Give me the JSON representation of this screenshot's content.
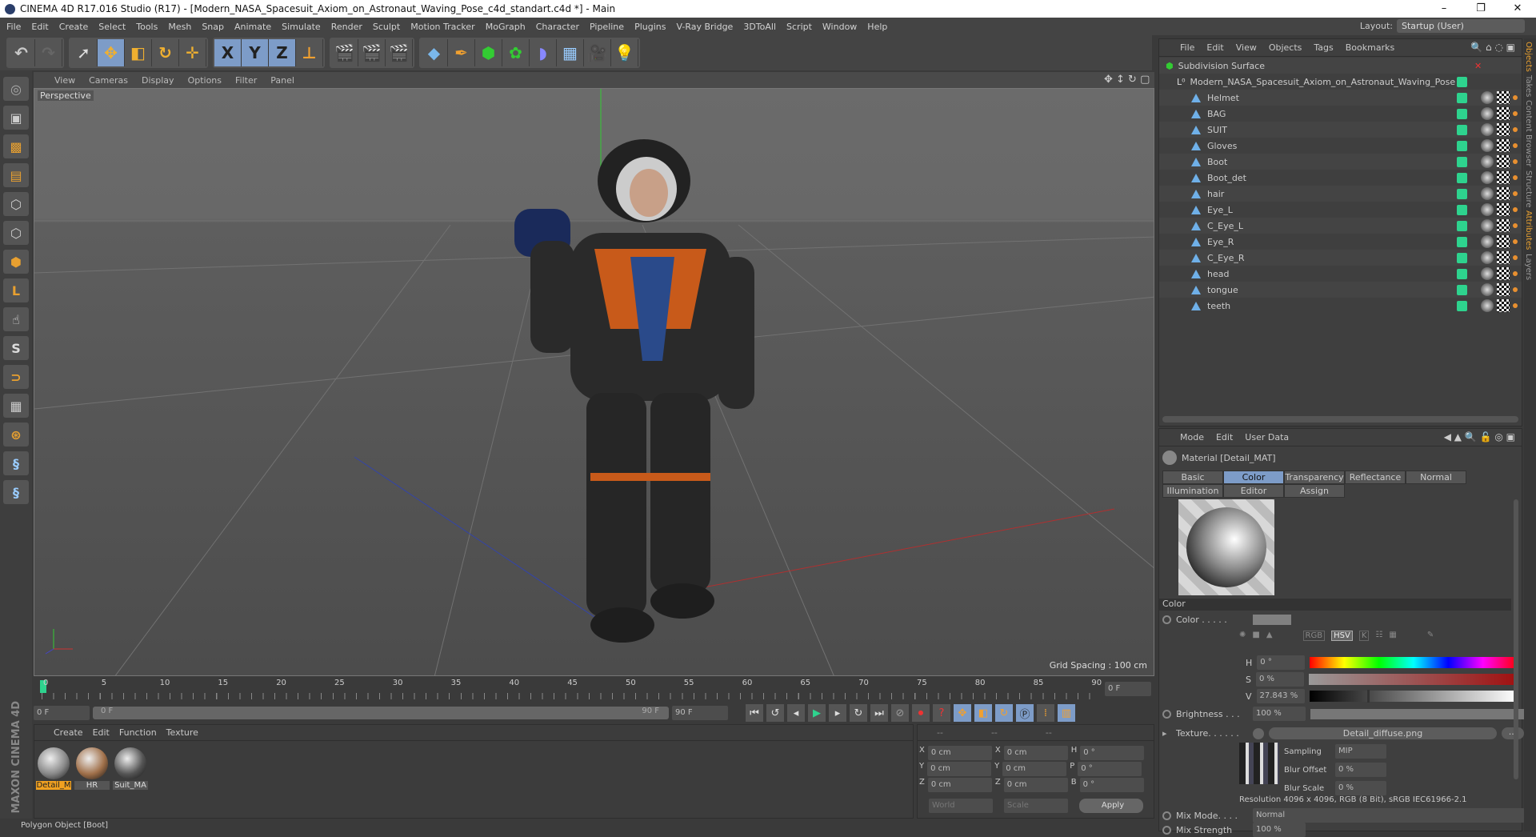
{
  "window": {
    "title": "CINEMA 4D R17.016 Studio (R17) - [Modern_NASA_Spacesuit_Axiom_on_Astronaut_Waving_Pose_c4d_standart.c4d *] - Main",
    "minimize": "–",
    "maximize": "❐",
    "close": "✕"
  },
  "menu": [
    "File",
    "Edit",
    "Create",
    "Select",
    "Tools",
    "Mesh",
    "Snap",
    "Animate",
    "Simulate",
    "Render",
    "Sculpt",
    "Motion Tracker",
    "MoGraph",
    "Character",
    "Pipeline",
    "Plugins",
    "V-Ray Bridge",
    "3DToAll",
    "Script",
    "Window",
    "Help"
  ],
  "layout": {
    "label": "Layout:",
    "value": "Startup (User)"
  },
  "toolbar": {
    "x": "X",
    "y": "Y",
    "z": "Z"
  },
  "viewport": {
    "menu": [
      "View",
      "Cameras",
      "Display",
      "Options",
      "Filter",
      "Panel"
    ],
    "camera": "Perspective",
    "grid_spacing": "Grid Spacing : 100 cm"
  },
  "timeline": {
    "ticks": [
      "0",
      "5",
      "10",
      "15",
      "20",
      "25",
      "30",
      "35",
      "40",
      "45",
      "50",
      "55",
      "60",
      "65",
      "70",
      "75",
      "80",
      "85",
      "90"
    ],
    "current": "0 F",
    "start": "0 F",
    "range_start": "0 F",
    "range_end": "90 F",
    "end": "90 F"
  },
  "material_manager": {
    "menu": [
      "Create",
      "Edit",
      "Function",
      "Texture"
    ],
    "materials": [
      {
        "name": "Detail_MAT",
        "label": "Detail_M",
        "color": "#888"
      },
      {
        "name": "HR",
        "label": "HR",
        "color": "#a0704a"
      },
      {
        "name": "Suit_MAT",
        "label": "Suit_MA",
        "color": "#555"
      }
    ]
  },
  "coordinates": {
    "headers": [
      "--",
      "--",
      "--"
    ],
    "rows": [
      {
        "a": "X",
        "av": "0 cm",
        "b": "X",
        "bv": "0 cm",
        "c": "H",
        "cv": "0 °"
      },
      {
        "a": "Y",
        "av": "0 cm",
        "b": "Y",
        "bv": "0 cm",
        "c": "P",
        "cv": "0 °"
      },
      {
        "a": "Z",
        "av": "0 cm",
        "b": "Z",
        "bv": "0 cm",
        "c": "B",
        "cv": "0 °"
      }
    ],
    "world": "World",
    "scale": "Scale",
    "apply": "Apply"
  },
  "status": "Polygon Object [Boot]",
  "brand": "MAXON CINEMA 4D",
  "objects": {
    "menu": [
      "File",
      "Edit",
      "View",
      "Objects",
      "Tags",
      "Bookmarks"
    ],
    "root": "Subdivision Surface",
    "group": "Modern_NASA_Spacesuit_Axiom_on_Astronaut_Waving_Pose",
    "items": [
      "Helmet",
      "BAG",
      "SUIT",
      "Gloves",
      "Boot",
      "Boot_det",
      "hair",
      "Eye_L",
      "C_Eye_L",
      "Eye_R",
      "C_Eye_R",
      "head",
      "tongue",
      "teeth"
    ]
  },
  "attributes": {
    "menu": [
      "Mode",
      "Edit",
      "User Data"
    ],
    "title": "Material [Detail_MAT]",
    "tabs": [
      "Basic",
      "Color",
      "Transparency",
      "Reflectance",
      "Normal",
      "Illumination",
      "Editor",
      "Assign"
    ],
    "active_tab": "Color",
    "section": "Color",
    "color_label": "Color . . . . .",
    "color_modes": [
      "RGB",
      "HSV",
      "K"
    ],
    "h_label": "H",
    "h": "0 °",
    "s_label": "S",
    "s": "0 %",
    "v_label": "V",
    "v": "27.843 %",
    "v_fraction": 0.27843,
    "brightness_label": "Brightness . . .",
    "brightness": "100 %",
    "texture_label": "Texture. . . . . .",
    "texture": "Detail_diffuse.png",
    "texture_more": "...",
    "sampling_label": "Sampling",
    "sampling": "MIP",
    "blur_offset_label": "Blur Offset",
    "blur_offset": "0 %",
    "blur_scale_label": "Blur Scale",
    "blur_scale": "0 %",
    "resolution": "Resolution 4096 x 4096, RGB (8 Bit), sRGB IEC61966-2.1",
    "mix_mode_label": "Mix Mode. . . .",
    "mix_mode": "Normal",
    "mix_strength_label": "Mix Strength",
    "mix_strength": "100 %"
  },
  "side_tabs": [
    "Objects",
    "Takes",
    "Content Browser",
    "Structure",
    "Attributes",
    "Layers"
  ]
}
